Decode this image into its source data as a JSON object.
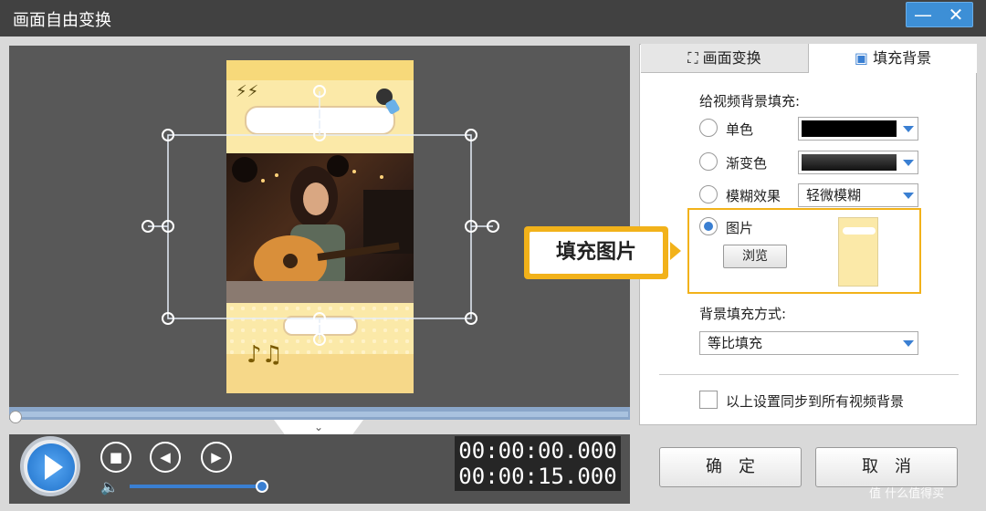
{
  "window": {
    "title": "画面自由变换",
    "minimize_glyph": "—",
    "close_glyph": "✕"
  },
  "preview": {
    "photo_description_icon": "guitar-photo",
    "sticker_bolts": "⚡⚡",
    "sticker_music": "♪♫"
  },
  "playback": {
    "current_time": "00:00:00.000",
    "total_time": "00:00:15.000",
    "progress_fraction": 0.0,
    "volume_fraction": 0.9,
    "stop_glyph": "■",
    "prev_glyph": "◀",
    "next_glyph": "▶"
  },
  "tabs": {
    "transform_label": "画面变换",
    "fill_label": "填充背景"
  },
  "fill_panel": {
    "heading": "给视频背景填充:",
    "option_solid": "单色",
    "option_gradient": "渐变色",
    "option_blur": "模糊效果",
    "blur_value": "轻微模糊",
    "option_image": "图片",
    "browse_label": "浏览",
    "mode_heading": "背景填充方式:",
    "mode_value": "等比填充",
    "sync_label": "以上设置同步到所有视频背景",
    "selected_option": "图片"
  },
  "callout": {
    "text": "填充图片"
  },
  "buttons": {
    "ok_label": "确定",
    "cancel_label": "取消"
  },
  "watermark": {
    "text": "值 什么值得买"
  },
  "colors": {
    "accent": "#3a7fd2",
    "highlight": "#f2b21a",
    "solid_swatch": "#000000",
    "gradient_swatch": "#2a2a2a"
  }
}
